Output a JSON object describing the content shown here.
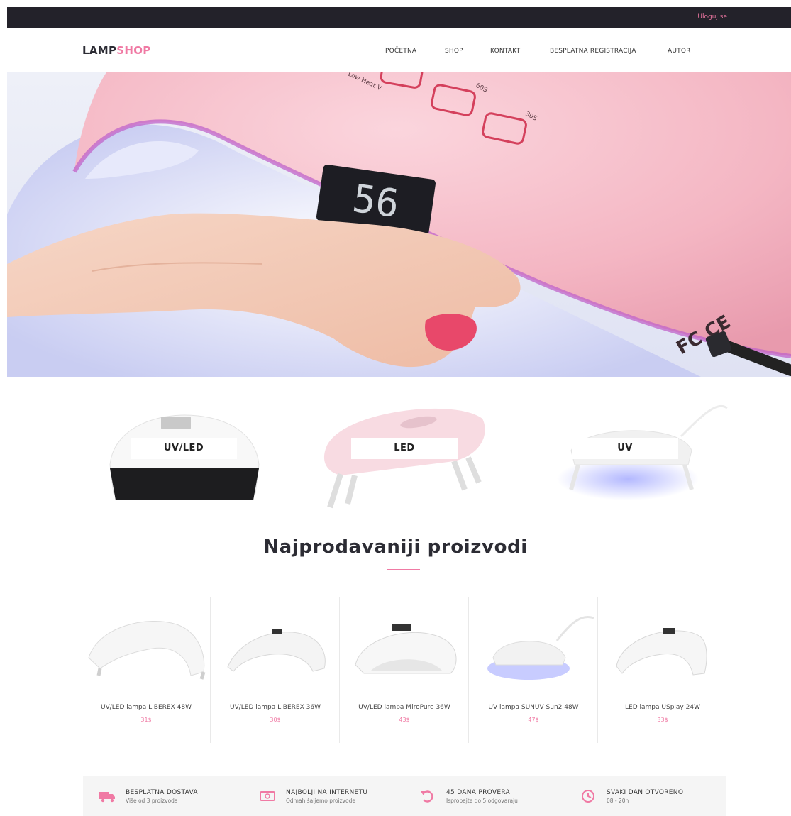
{
  "topbar": {
    "login_label": "Uloguj se"
  },
  "header": {
    "logo_part1": "LAMP",
    "logo_part2": "SHOP",
    "nav": [
      "POČETNA",
      "SHOP",
      "KONTAKT",
      "BESPLATNA REGISTRACIJA",
      "AUTOR"
    ]
  },
  "categories": [
    "UV/LED",
    "LED",
    "UV"
  ],
  "bestsellers": {
    "title": "Najprodavaniji proizvodi",
    "products": [
      {
        "name": "UV/LED lampa LIBEREX 48W",
        "price": "31$"
      },
      {
        "name": "UV/LED lampa LIBEREX 36W",
        "price": "30$"
      },
      {
        "name": "UV/LED lampa MiroPure 36W",
        "price": "43$"
      },
      {
        "name": "UV lampa SUNUV Sun2 48W",
        "price": "47$"
      },
      {
        "name": "LED lampa USplay 24W",
        "price": "33$"
      }
    ]
  },
  "features": [
    {
      "title": "BESPLATNA DOSTAVA",
      "subtitle": "Više od 3 proizvoda",
      "icon": "truck-icon"
    },
    {
      "title": "NAJBOLJI NA INTERNETU",
      "subtitle": "Odmah šaljemo proizvode",
      "icon": "money-icon"
    },
    {
      "title": "45 DANA PROVERA",
      "subtitle": "Isprobajte do 5 odgovaraju",
      "icon": "return-icon"
    },
    {
      "title": "SVAKI DAN OTVORENO",
      "subtitle": "08 - 20h",
      "icon": "clock-icon"
    }
  ],
  "hero": {
    "display_readout": "56",
    "label_60s": "60S",
    "label_30s": "30S",
    "label_low_heat": "Low Heat V",
    "cert_mark": "FC CE"
  },
  "colors": {
    "accent": "#f07aa4",
    "topbar": "#23222a",
    "feature_bg": "#f5f5f5"
  }
}
